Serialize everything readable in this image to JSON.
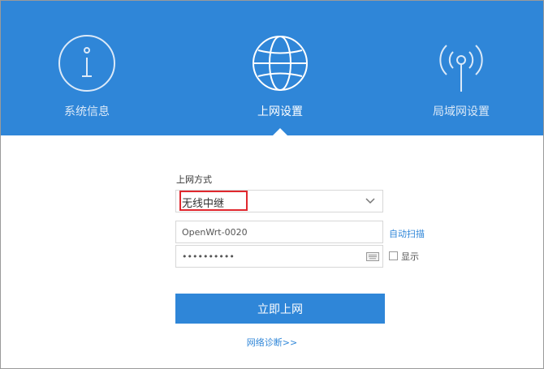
{
  "nav": {
    "items": [
      {
        "label": "系统信息",
        "icon": "info-icon"
      },
      {
        "label": "上网设置",
        "icon": "globe-icon",
        "active": true
      },
      {
        "label": "局域网设置",
        "icon": "wireless-signal-icon"
      }
    ]
  },
  "form": {
    "mode_label": "上网方式",
    "mode_value": "无线中继",
    "ssid_value": "OpenWrt-0020",
    "auto_scan_label": "自动扫描",
    "password_value": "••••••••••",
    "show_label": "显示",
    "submit_label": "立即上网",
    "diagnose_label": "网络诊断>>"
  },
  "colors": {
    "brand": "#2f86d8",
    "highlight": "#e0282e"
  }
}
